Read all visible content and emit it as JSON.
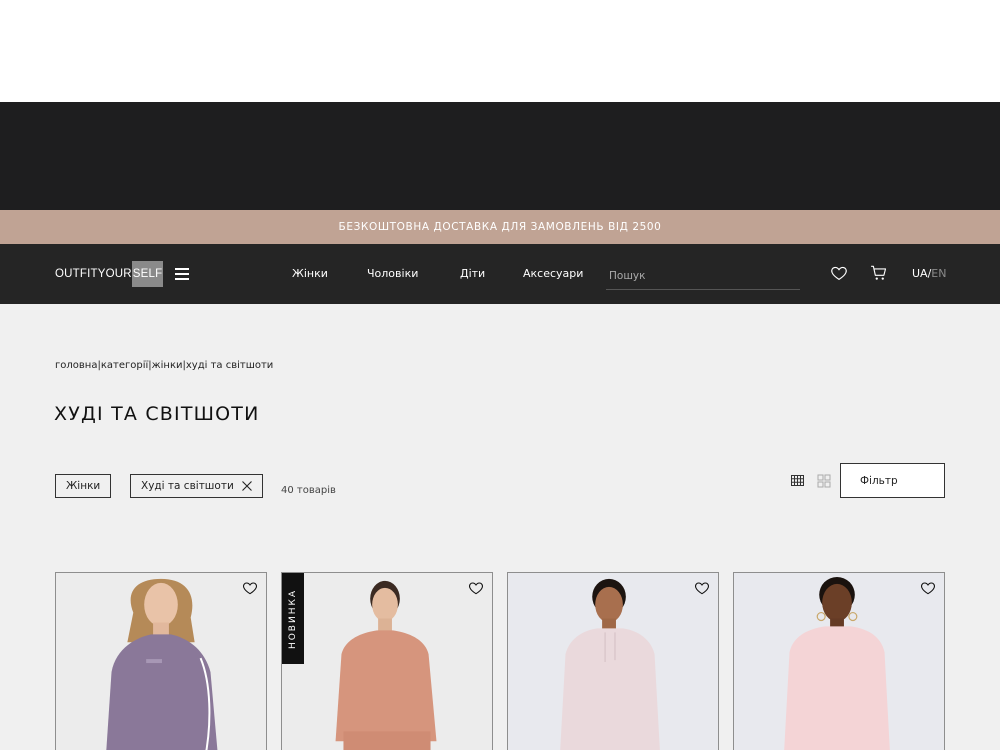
{
  "promo": {
    "text": "БЕЗКОШТОВНА ДОСТАВКА ДЛЯ ЗАМОВЛЕНЬ ВІД  2500"
  },
  "header": {
    "logo_main": "OUTFITYOUR",
    "logo_highlight": "SELF",
    "nav": [
      "Жінки",
      "Чоловіки",
      "Діти",
      "Аксесуари"
    ],
    "search_placeholder": "Пошук",
    "lang_active": "UA",
    "lang_separator": "/",
    "lang_inactive": "EN",
    "icons": [
      "menu-icon",
      "heart-icon",
      "cart-icon"
    ]
  },
  "breadcrumb": {
    "items": [
      "головна",
      "категорії",
      "жінки",
      "худі та світшоти"
    ],
    "separator": "|"
  },
  "page_title": "ХУДІ ТА СВІТШОТИ",
  "filters": {
    "chips": [
      "Жінки",
      "Худі та світшоти"
    ],
    "count": "40 товарів",
    "filter_button": "Фільтр",
    "view_icons": [
      "grid-4-icon",
      "grid-2-icon"
    ]
  },
  "products": [
    {
      "color": "#8a7899",
      "bg": "#ececec",
      "badge": ""
    },
    {
      "color": "#d6957d",
      "bg": "#ececec",
      "badge": "НОВИНКА"
    },
    {
      "color": "#ead9dc",
      "bg": "#e8e9ee",
      "badge": ""
    },
    {
      "color": "#f4d4d6",
      "bg": "#e8e9ee",
      "badge": ""
    }
  ],
  "colors": {
    "dark": "#1e1e1f",
    "header": "#252525",
    "promo": "#c0a394",
    "page_bg": "#f0f0f0"
  }
}
